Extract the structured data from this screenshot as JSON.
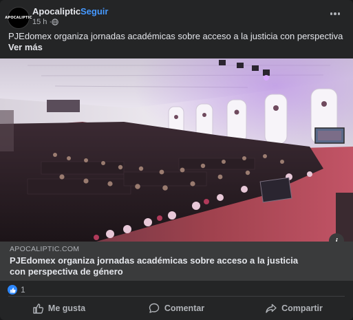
{
  "post": {
    "author": "Apocaliptic",
    "separator": "·",
    "follow_label": "Seguir",
    "timestamp": "15 h ·",
    "avatar_text": "APOCALIPTIC",
    "text": "PJEdomex organiza jornadas académicas sobre acceso a la justicia con perspectiva de género...",
    "see_more": "Ver más"
  },
  "link_preview": {
    "domain": "APOCALIPTIC.COM",
    "title": "PJEdomex organiza jornadas académicas sobre acceso a la justicia con perspectiva de género",
    "info_icon": "i"
  },
  "reactions": {
    "count": "1"
  },
  "actions": {
    "like": "Me gusta",
    "comment": "Comentar",
    "share": "Compartir"
  },
  "colors": {
    "accent": "#4599ff",
    "card_bg": "#242526",
    "link_bg": "#3a3b3c",
    "like_blue": "#2d88ff"
  }
}
